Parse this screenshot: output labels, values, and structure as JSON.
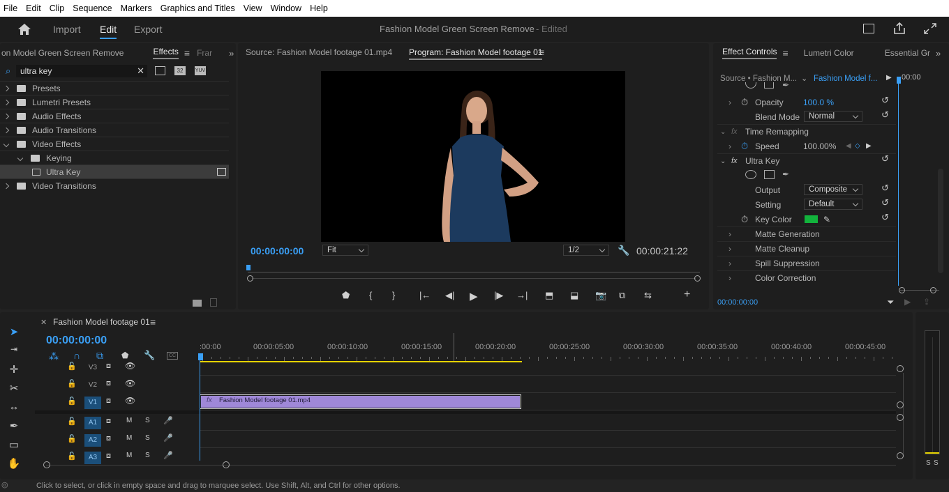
{
  "menu": [
    "File",
    "Edit",
    "Clip",
    "Sequence",
    "Markers",
    "Graphics and Titles",
    "View",
    "Window",
    "Help"
  ],
  "header": {
    "tabs": [
      "Import",
      "Edit",
      "Export"
    ],
    "project_title": "Fashion Model Green Screen Remove",
    "edited": "- Edited"
  },
  "project_panel": {
    "tabs": [
      "on Model Green Screen Remove",
      "Effects",
      "Frar"
    ],
    "search_value": "ultra key",
    "tree": [
      {
        "label": "Presets",
        "level": 0,
        "open": false
      },
      {
        "label": "Lumetri Presets",
        "level": 0,
        "open": false
      },
      {
        "label": "Audio Effects",
        "level": 0,
        "open": false
      },
      {
        "label": "Audio Transitions",
        "level": 0,
        "open": false
      },
      {
        "label": "Video Effects",
        "level": 0,
        "open": true
      },
      {
        "label": "Keying",
        "level": 1,
        "open": true
      },
      {
        "label": "Ultra Key",
        "level": 2,
        "selected": true
      },
      {
        "label": "Video Transitions",
        "level": 0,
        "open": false
      }
    ]
  },
  "monitor": {
    "source_tab": "Source: Fashion Model footage 01.mp4",
    "program_tab": "Program: Fashion Model footage 01",
    "timecode": "00:00:00:00",
    "fit": "Fit",
    "res": "1/2",
    "duration": "00:00:21:22"
  },
  "effect_controls": {
    "tabs": [
      "Effect Controls",
      "Lumetri Color",
      "Essential Gr"
    ],
    "source": "Source • Fashion M...",
    "clip": "Fashion Model f...",
    "time": "00:00",
    "opacity_label": "Opacity",
    "opacity_value": "100.0 %",
    "blend_label": "Blend Mode",
    "blend_value": "Normal",
    "time_remap": "Time Remapping",
    "speed_label": "Speed",
    "speed_value": "100.00%",
    "ultra_key": "Ultra Key",
    "output_label": "Output",
    "output_value": "Composite",
    "setting_label": "Setting",
    "setting_value": "Default",
    "key_label": "Key Color",
    "key_color": "#12b33c",
    "groups": [
      "Matte Generation",
      "Matte Cleanup",
      "Spill Suppression",
      "Color Correction"
    ],
    "footer_time": "00:00:00:00"
  },
  "timeline": {
    "tab": "Fashion Model footage 01",
    "timecode": "00:00:00:00",
    "ruler": [
      ":00:00",
      "00:00:05:00",
      "00:00:10:00",
      "00:00:15:00",
      "00:00:20:00",
      "00:00:25:00",
      "00:00:30:00",
      "00:00:35:00",
      "00:00:40:00",
      "00:00:45:00"
    ],
    "tracks": [
      "V3",
      "V2",
      "V1",
      "A1",
      "A2",
      "A3"
    ],
    "clip_name": "Fashion Model footage 01.mp4",
    "clip_color": "#9f88d8"
  },
  "meter_labels": [
    "S",
    "S"
  ],
  "status": "Click to select, or click in empty space and drag to marquee select. Use Shift, Alt, and Ctrl for other options."
}
